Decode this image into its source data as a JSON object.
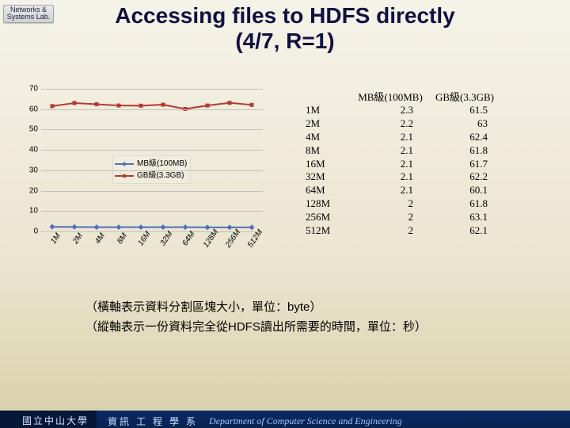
{
  "logo": {
    "line1": "Networks &",
    "line2": "Systems Lab."
  },
  "title_line1": "Accessing files to HDFS directly",
  "title_line2": "(4/7, R=1)",
  "chart_data": {
    "type": "line",
    "categories": [
      "1M",
      "2M",
      "4M",
      "8M",
      "16M",
      "32M",
      "64M",
      "128M",
      "256M",
      "512M"
    ],
    "series": [
      {
        "name": "MB級(100MB)",
        "color": "#4e72b8",
        "values": [
          2.3,
          2.2,
          2.1,
          2.1,
          2.1,
          2.1,
          2.1,
          2,
          2,
          2
        ]
      },
      {
        "name": "GB級(3.3GB)",
        "color": "#b23a30",
        "values": [
          61.5,
          63,
          62.4,
          61.8,
          61.7,
          62.2,
          60.1,
          61.8,
          63.1,
          62.1
        ]
      }
    ],
    "ylim": [
      0,
      70
    ],
    "yticks": [
      0,
      10,
      20,
      30,
      40,
      50,
      60,
      70
    ],
    "xlabel": "",
    "ylabel": ""
  },
  "legend": {
    "mb": "MB級(100MB)",
    "gb": "GB級(3.3GB)"
  },
  "table": {
    "col1": "MB級(100MB)",
    "col2": "GB級(3.3GB)",
    "rows": [
      {
        "cat": "1M",
        "a": "2.3",
        "b": "61.5"
      },
      {
        "cat": "2M",
        "a": "2.2",
        "b": "63"
      },
      {
        "cat": "4M",
        "a": "2.1",
        "b": "62.4"
      },
      {
        "cat": "8M",
        "a": "2.1",
        "b": "61.8"
      },
      {
        "cat": "16M",
        "a": "2.1",
        "b": "61.7"
      },
      {
        "cat": "32M",
        "a": "2.1",
        "b": "62.2"
      },
      {
        "cat": "64M",
        "a": "2.1",
        "b": "60.1"
      },
      {
        "cat": "128M",
        "a": "2",
        "b": "61.8"
      },
      {
        "cat": "256M",
        "a": "2",
        "b": "63.1"
      },
      {
        "cat": "512M",
        "a": "2",
        "b": "62.1"
      }
    ]
  },
  "caption1": "（橫軸表示資料分割區塊大小，單位：byte）",
  "caption2": "（縱軸表示一份資料完全從HDFS讀出所需要的時間，單位：秒）",
  "footer": {
    "uni": "國立中山大學",
    "dept_zh": "資訊 工 程 學 系",
    "dept_en": "Department of Computer Science and Engineering"
  }
}
